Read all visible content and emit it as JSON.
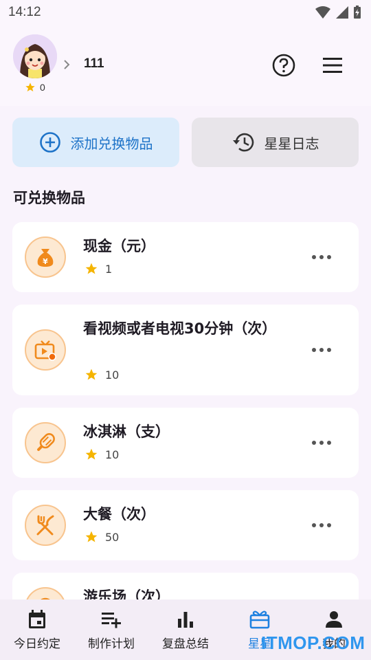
{
  "status_bar": {
    "time": "14:12"
  },
  "header": {
    "user_name": "111",
    "star_count": "0"
  },
  "actions": {
    "add_label": "添加兑换物品",
    "log_label": "星星日志"
  },
  "section_title": "可兑换物品",
  "items": [
    {
      "title": "现金（元）",
      "stars": "1",
      "icon": "money-bag-icon"
    },
    {
      "title": "看视频或者电视30分钟（次）",
      "stars": "10",
      "icon": "tv-icon"
    },
    {
      "title": "冰淇淋（支）",
      "stars": "10",
      "icon": "ice-cream-icon"
    },
    {
      "title": "大餐（次）",
      "stars": "50",
      "icon": "fork-knife-icon"
    },
    {
      "title": "游乐场（次）",
      "stars": "",
      "icon": "ferris-wheel-icon"
    }
  ],
  "nav": [
    {
      "label": "今日约定",
      "icon": "calendar-icon"
    },
    {
      "label": "制作计划",
      "icon": "playlist-add-icon"
    },
    {
      "label": "复盘总结",
      "icon": "bar-chart-icon"
    },
    {
      "label": "星星",
      "icon": "gift-icon",
      "active": true
    },
    {
      "label": "我的",
      "icon": "person-icon"
    }
  ],
  "watermark": "ITMOP.COM",
  "colors": {
    "accent_blue": "#1e80e0",
    "star_yellow": "#f5b400",
    "icon_orange": "#f08a1c"
  }
}
